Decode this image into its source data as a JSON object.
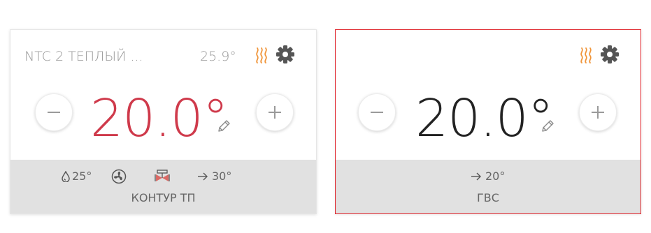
{
  "cards": [
    {
      "title": "NTC 2 ТЕПЛЫЙ ...",
      "current_temp": "25.9°",
      "setpoint": "20.0°",
      "footer": {
        "drop_temp": "25°",
        "flow_temp": "30°",
        "name": "КОНТУР ТП"
      },
      "accent_color": "#cf3a4b"
    },
    {
      "title": "",
      "current_temp": "",
      "setpoint": "20.0°",
      "footer": {
        "flow_temp": "20°",
        "name": "ГВС"
      },
      "selected": true,
      "border_color": "#e0242b"
    }
  ],
  "icons": {
    "heating": "heating-waves-icon",
    "settings": "gear-icon",
    "decrease": "minus-icon",
    "increase": "plus-icon",
    "edit": "pencil-icon",
    "drop": "drop-icon",
    "fan": "fan-icon",
    "valve": "valve-icon",
    "arrow": "arrow-right-icon"
  },
  "colors": {
    "heating_icon": "#f0953a",
    "gear_icon": "#555555",
    "footer_bg": "#e1e1e1",
    "valve_icon": "#d9534f"
  }
}
